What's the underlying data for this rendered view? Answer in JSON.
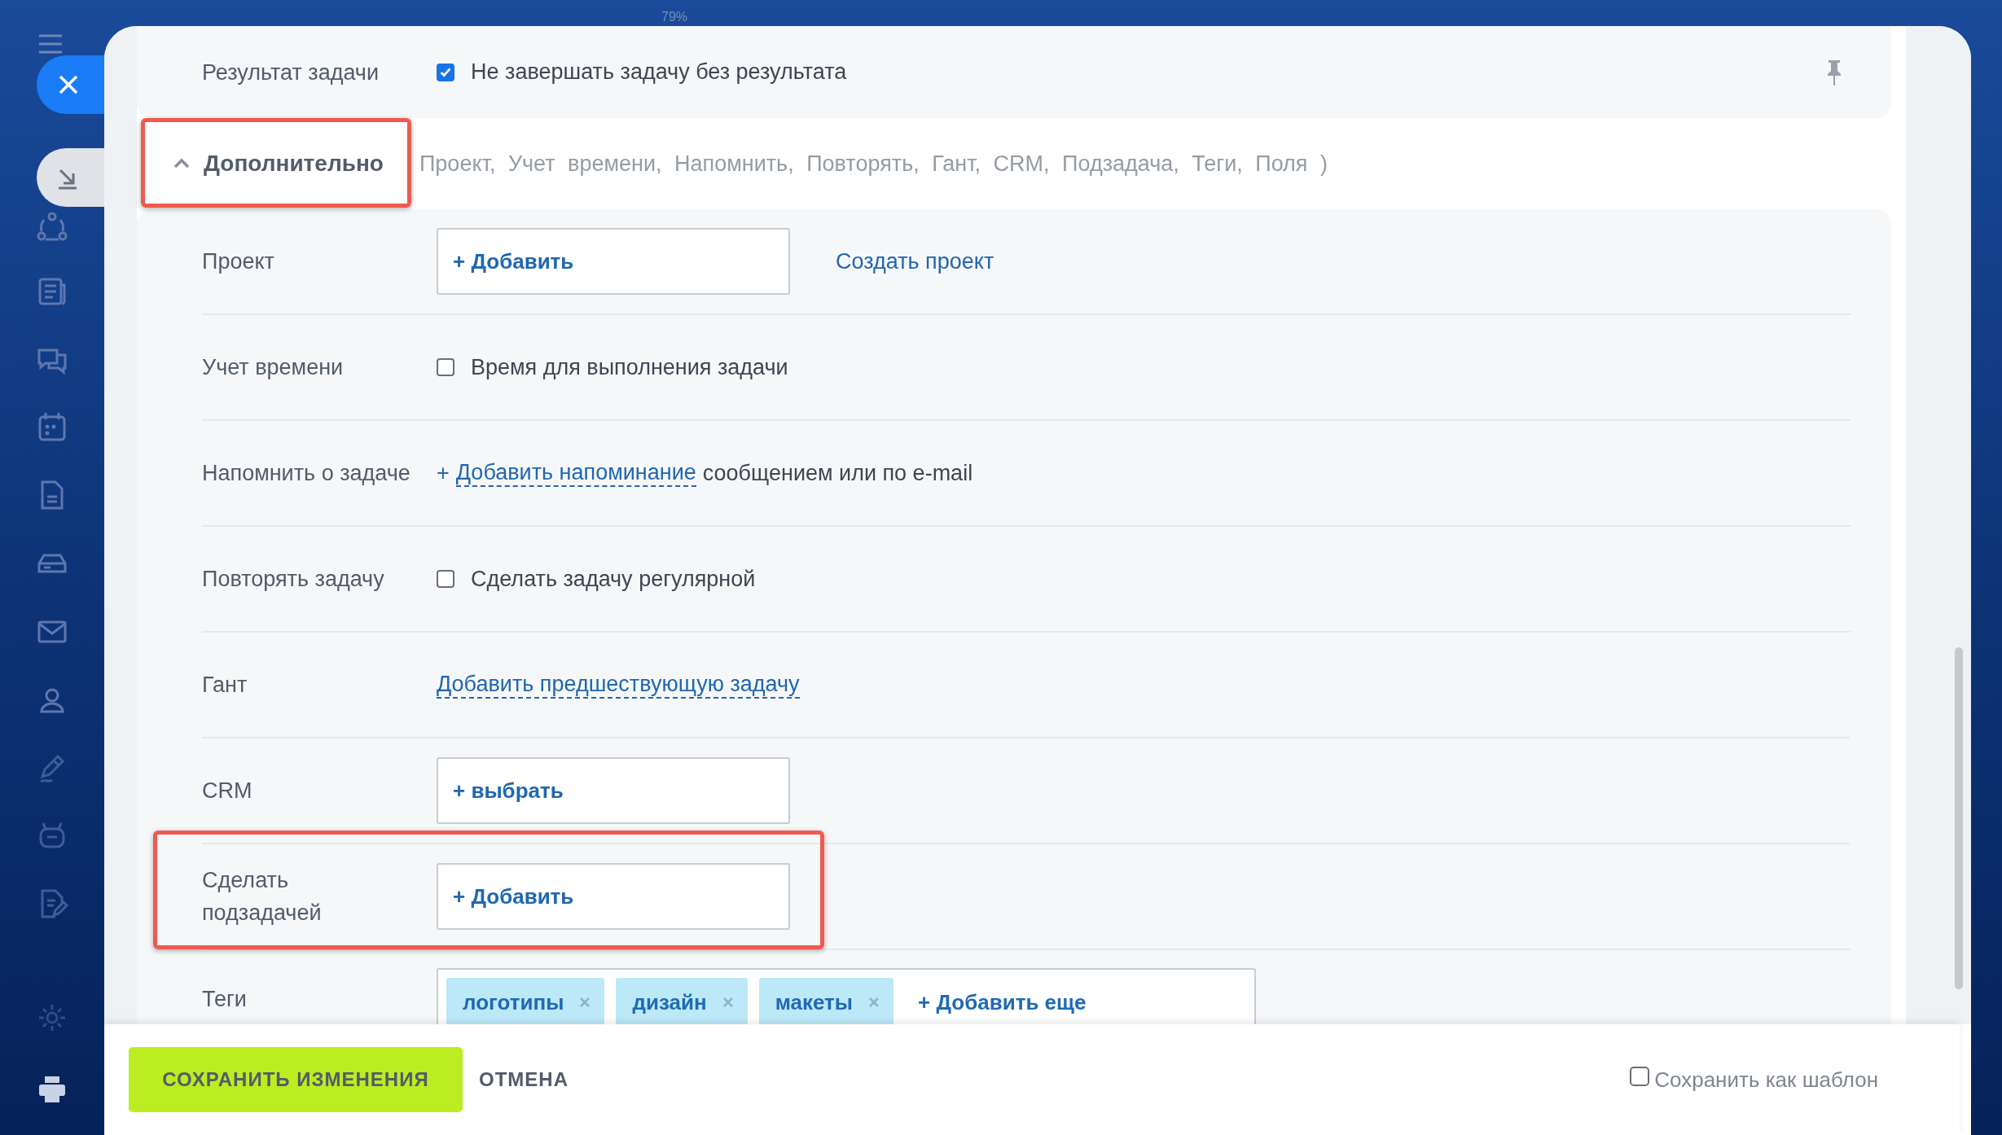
{
  "zoom_label": "79%",
  "result": {
    "label": "Результат задачи",
    "checked": true,
    "text": "Не завершать задачу без результата"
  },
  "section": {
    "title": "Дополнительно",
    "expanded": true,
    "summary": [
      "Проект,",
      "Учет времени,",
      "Напомнить,",
      "Повторять,",
      "Гант,",
      "CRM,",
      "Подзадача,",
      "Теги,",
      "Поля )"
    ]
  },
  "rows": [
    {
      "label": "Проект",
      "kind": "add-field",
      "button": "+ Добавить",
      "link": "Создать проект"
    },
    {
      "label": "Учет времени",
      "kind": "checkbox",
      "checked": false,
      "text": "Время для выполнения задачи"
    },
    {
      "label": "Напомнить о задаче",
      "kind": "reminder",
      "plus": "+",
      "link": "Добавить напоминание",
      "text": "сообщением или по e-mail"
    },
    {
      "label": "Повторять задачу",
      "kind": "checkbox",
      "checked": false,
      "text": "Сделать задачу регулярной"
    },
    {
      "label": "Гант",
      "kind": "link",
      "link": "Добавить предшествующую задачу"
    },
    {
      "label": "CRM",
      "kind": "add-field",
      "button": "+ выбрать"
    },
    {
      "label": "Сделать подзадачей",
      "kind": "add-field",
      "button": "+ Добавить"
    },
    {
      "label": "Теги",
      "kind": "tags",
      "tags": [
        "логотипы",
        "дизайн",
        "макеты"
      ],
      "button": "+ Добавить еще"
    }
  ],
  "footer": {
    "save": "СОХРАНИТЬ ИЗМЕНЕНИЯ",
    "cancel": "ОТМЕНА",
    "template": {
      "checked": false,
      "text": "Сохранить как шаблон"
    }
  }
}
